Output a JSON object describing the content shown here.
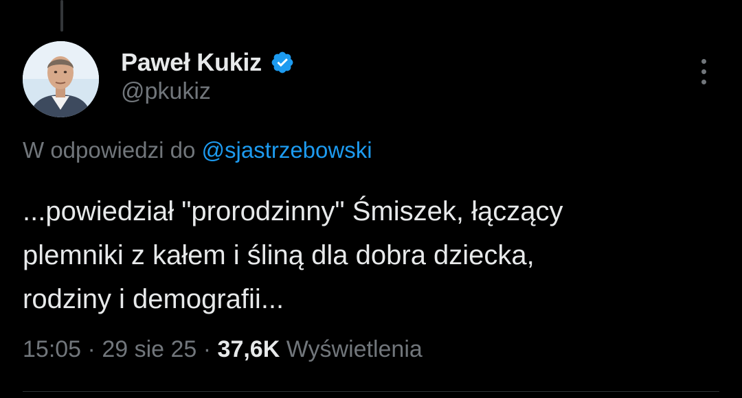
{
  "author": {
    "name": "Paweł Kukiz",
    "handle": "@pkukiz"
  },
  "reply": {
    "prefix": "W odpowiedzi do ",
    "mention": "@sjastrzebowski"
  },
  "tweet": {
    "lines": [
      "...powiedział \"prorodzinny\" Śmiszek, łączący",
      "plemniki z kałem i śliną dla dobra dziecka,",
      "rodziny i demografii..."
    ]
  },
  "meta": {
    "time": "15:05",
    "separator": " · ",
    "date": "29 sie 25",
    "views_count": "37,6K",
    "views_label": "Wyświetlenia"
  },
  "icons": {
    "verified": "verified-badge-icon",
    "more": "more-options-icon"
  },
  "colors": {
    "background": "#000000",
    "text": "#e7e9ea",
    "secondary": "#71767b",
    "accent": "#1d9bf0"
  }
}
